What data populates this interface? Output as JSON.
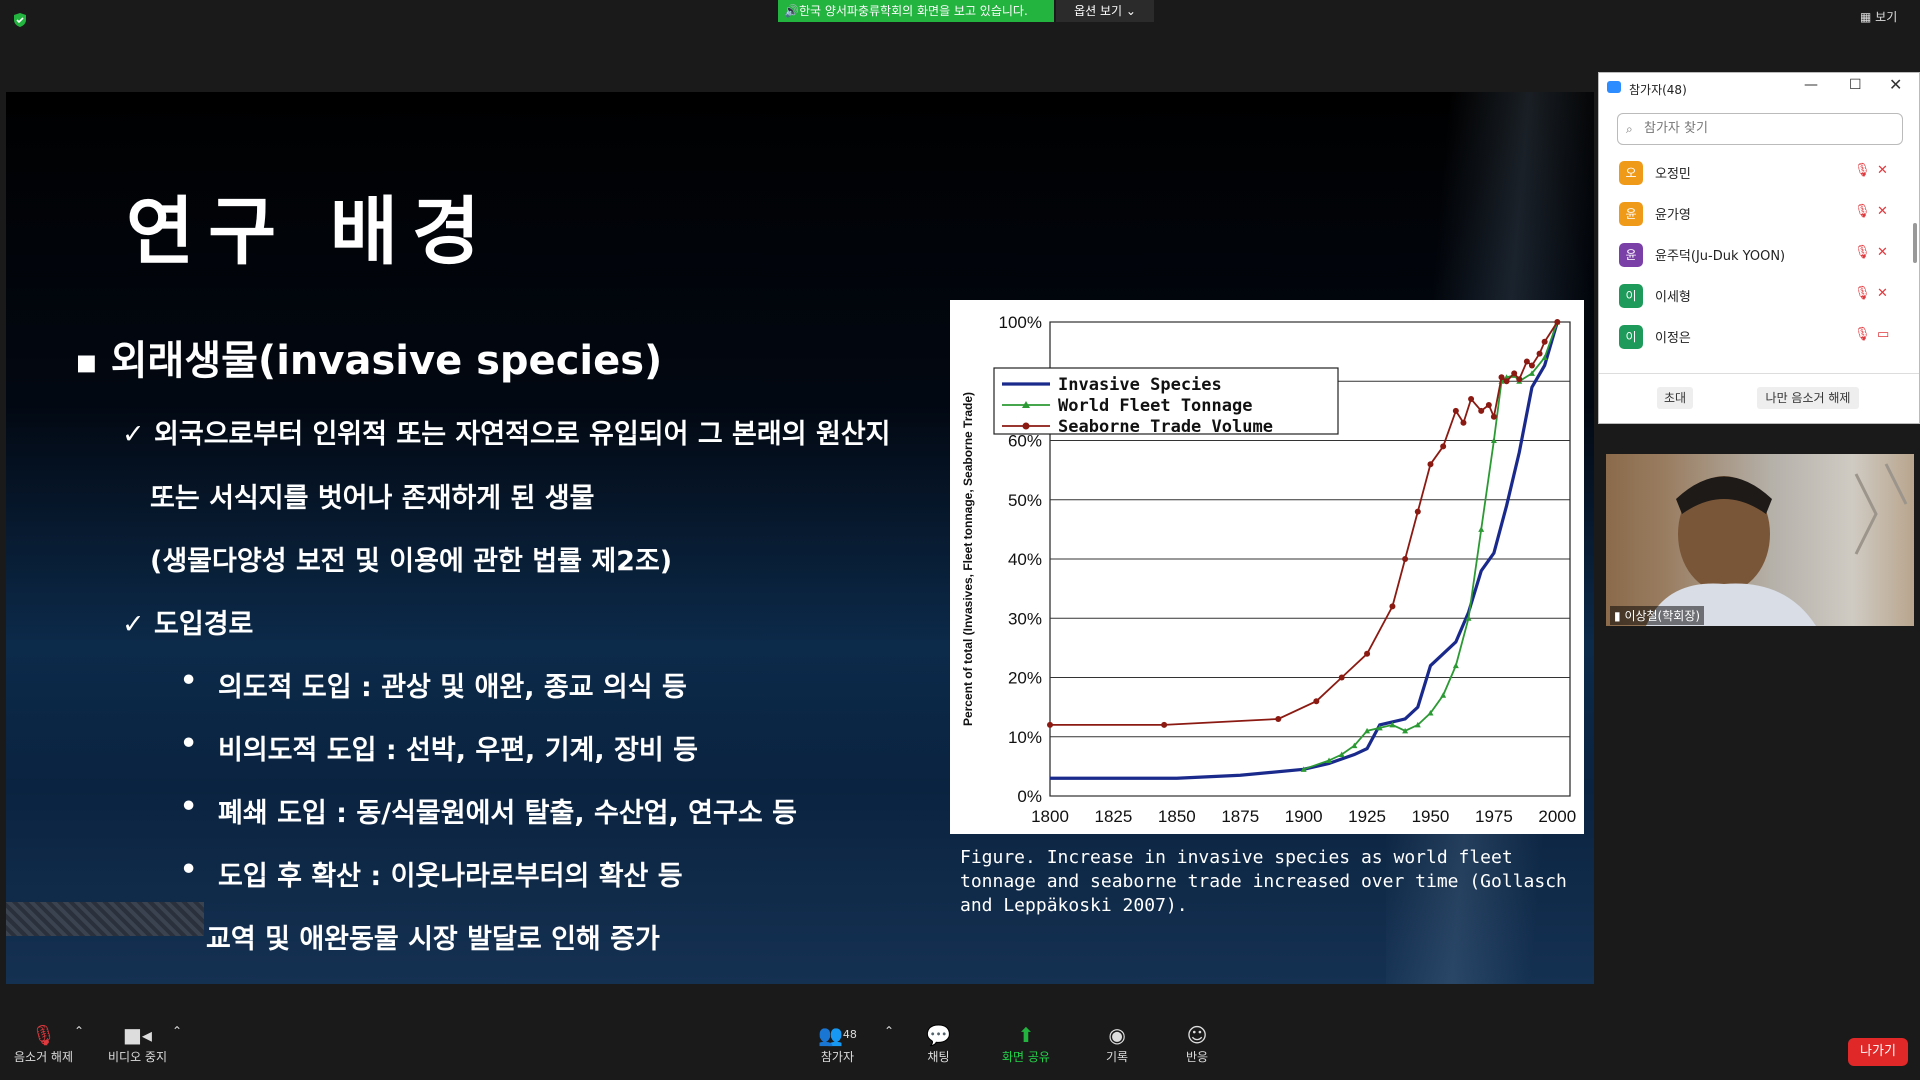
{
  "top": {
    "share_banner": "한국 양서파충류학회의 화면을 보고 있습니다.",
    "view_options": "옵션 보기",
    "view_button": "보기"
  },
  "slide": {
    "title": "연구 배경",
    "heading": "외래생물(invasive species)",
    "def_line1": "✓ 외국으로부터 인위적 또는 자연적으로 유입되어 그 본래의 원산지",
    "def_line2": "또는 서식지를 벗어나 존재하게 된 생물",
    "def_line3": "(생물다양성 보전 및 이용에 관한 법률 제2조)",
    "route_heading": "✓ 도입경로",
    "routes": [
      "의도적 도입 : 관상 및 애완, 종교 의식 등",
      "비의도적 도입 : 선박, 우편, 기계, 장비 등",
      "폐쇄 도입 : 동/식물원에서 탈출, 수산업, 연구소 등",
      "도입 후 확산 : 이웃나라로부터의 확산 등"
    ],
    "last_line": "교역 및 애완동물 시장 발달로 인해 증가",
    "caption": "Figure. Increase in invasive species as world fleet tonnage and seaborne trade increased over time (Gollasch and Leppäkoski 2007)."
  },
  "chart_data": {
    "type": "line",
    "ylabel": "Percent of total (Invasives, Fleet tonnage, Seaborne Trade)",
    "xlabel": "",
    "x_ticks": [
      1800,
      1825,
      1850,
      1875,
      1900,
      1925,
      1950,
      1975,
      2000
    ],
    "y_ticks": [
      "0%",
      "10%",
      "20%",
      "30%",
      "40%",
      "50%",
      "60%",
      "70%",
      "100%"
    ],
    "y_tick_values": [
      0,
      10,
      20,
      30,
      40,
      50,
      60,
      70,
      100
    ],
    "xlim": [
      1800,
      2005
    ],
    "ylim": [
      0,
      100
    ],
    "legend_position": "top-left",
    "series": [
      {
        "name": "Invasive Species",
        "color": "#1a2a8c",
        "marker": "none",
        "x": [
          1800,
          1850,
          1875,
          1900,
          1910,
          1920,
          1925,
          1930,
          1940,
          1945,
          1950,
          1955,
          1960,
          1965,
          1970,
          1975,
          1980,
          1985,
          1990,
          1995,
          2000
        ],
        "y": [
          3,
          3,
          3.5,
          4.5,
          5.5,
          7,
          8,
          12,
          13,
          15,
          22,
          24,
          26,
          31,
          38,
          41,
          49,
          58,
          69,
          78,
          100
        ]
      },
      {
        "name": "World Fleet Tonnage",
        "color": "#2c9a34",
        "marker": "triangle",
        "x": [
          1900,
          1910,
          1915,
          1920,
          1925,
          1930,
          1935,
          1940,
          1945,
          1950,
          1955,
          1960,
          1965,
          1970,
          1975,
          1978,
          1980,
          1983,
          1985,
          1990,
          1995,
          2000
        ],
        "y": [
          4.5,
          6,
          7,
          8.5,
          11,
          11.5,
          12,
          11,
          12,
          14,
          17,
          22,
          30,
          45,
          60,
          70,
          72,
          73,
          70,
          74,
          82,
          100
        ]
      },
      {
        "name": "Seaborne Trade Volume",
        "color": "#8b1a12",
        "marker": "circle",
        "x": [
          1800,
          1845,
          1890,
          1905,
          1915,
          1925,
          1935,
          1940,
          1945,
          1950,
          1955,
          1960,
          1963,
          1966,
          1970,
          1973,
          1975,
          1978,
          1980,
          1983,
          1985,
          1988,
          1990,
          1993,
          1995,
          2000
        ],
        "y": [
          12,
          12,
          13,
          16,
          20,
          24,
          32,
          40,
          48,
          56,
          59,
          65,
          63,
          67,
          65,
          66,
          64,
          72,
          70,
          74,
          71,
          80,
          78,
          84,
          90,
          100
        ]
      }
    ]
  },
  "panel": {
    "title": "참가자(48)",
    "search_placeholder": "참가자 찾기",
    "participants": [
      {
        "initial": "오",
        "name": "오정민",
        "color": "#f09a1a",
        "cam": "✕"
      },
      {
        "initial": "윤",
        "name": "윤가영",
        "color": "#f09a1a",
        "cam": "✕"
      },
      {
        "initial": "윤",
        "name": "윤주덕(Ju-Duk YOON)",
        "color": "#7b3fa8",
        "cam": "✕"
      },
      {
        "initial": "이",
        "name": "이세형",
        "color": "#1e9a5a",
        "cam": "✕"
      },
      {
        "initial": "이",
        "name": "이정은",
        "color": "#1e9a5a",
        "cam": "▭"
      }
    ],
    "invite": "초대",
    "unmute_me": "나만 음소거 해제"
  },
  "video": {
    "name": "이상철(학회장)"
  },
  "toolbar": {
    "unmute": "음소거 해제",
    "stop_video": "비디오 중지",
    "participants": "참가자",
    "participants_count": "48",
    "chat": "채팅",
    "share": "화면 공유",
    "record": "기록",
    "reactions": "반응",
    "leave": "나가기"
  }
}
